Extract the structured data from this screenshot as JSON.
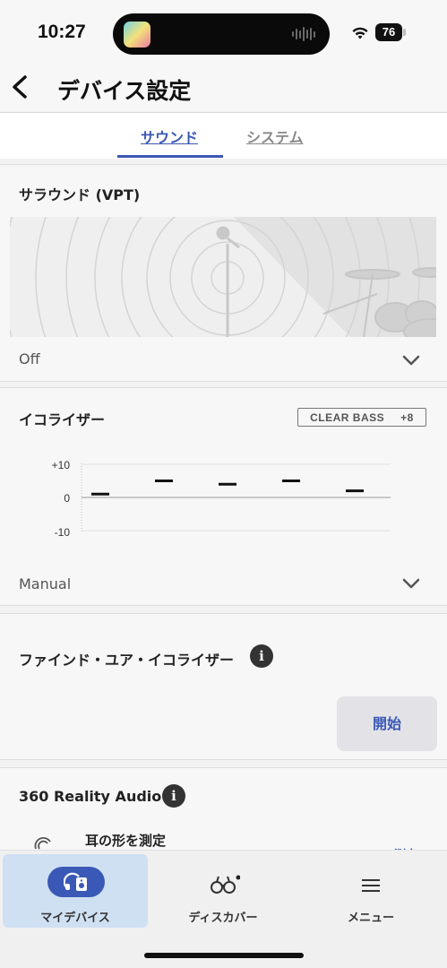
{
  "status_bar": {
    "time": "10:27",
    "battery": "76"
  },
  "header": {
    "title": "デバイス設定"
  },
  "tabs": [
    {
      "label": "サウンド",
      "active": true
    },
    {
      "label": "システム",
      "active": false
    }
  ],
  "surround": {
    "title": "サラウンド (VPT)",
    "value": "Off"
  },
  "equalizer": {
    "title": "イコライザー",
    "clear_bass_label": "CLEAR BASS",
    "clear_bass_value": "+8",
    "preset": "Manual",
    "chart_labels": {
      "max": "+10",
      "zero": "0",
      "min": "-10"
    }
  },
  "chart_data": {
    "type": "line",
    "categories": [
      "",
      "",
      "",
      "",
      ""
    ],
    "values": [
      1,
      5,
      4,
      5,
      2
    ],
    "ylim": [
      -10,
      10
    ],
    "yticks": [
      "+10",
      "0",
      "-10"
    ],
    "grid": true
  },
  "find_your_eq": {
    "title": "ファインド・ユア・イコライザー",
    "info_icon": "info-icon",
    "start_label": "開始"
  },
  "reality_audio": {
    "title": "360 Reality Audio",
    "info_icon": "info-icon",
    "ear_label": "耳の形を測定",
    "measure_label": "測定"
  },
  "bottom_nav": [
    {
      "label": "マイデバイス",
      "icon": "headphones-icon",
      "active": true
    },
    {
      "label": "ディスカバー",
      "icon": "binoculars-icon",
      "active": false
    },
    {
      "label": "メニュー",
      "icon": "hamburger-menu-icon",
      "active": false
    }
  ],
  "colors": {
    "accent": "#3a58b5",
    "active_nav_bg": "#cfe0f3"
  }
}
